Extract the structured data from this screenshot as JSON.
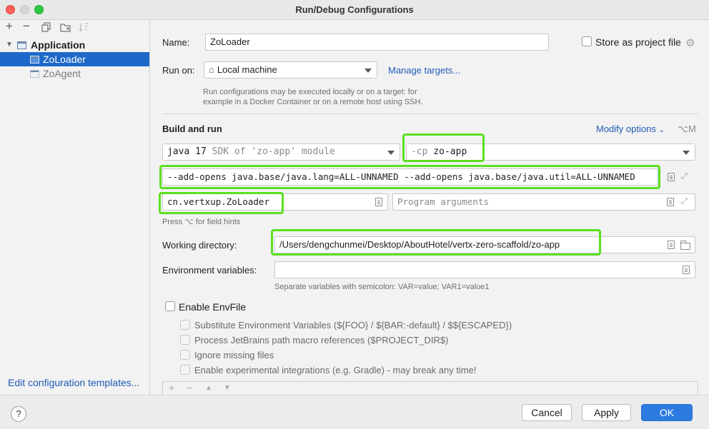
{
  "window": {
    "title": "Run/Debug Configurations"
  },
  "sidebar": {
    "toolbar": [
      "add-icon",
      "remove-icon",
      "copy-icon",
      "new-folder-icon",
      "sort-icon"
    ],
    "tree": {
      "group_label": "Application",
      "items": [
        {
          "label": "ZoLoader",
          "selected": true
        },
        {
          "label": "ZoAgent",
          "selected": false
        }
      ]
    },
    "edit_templates_link": "Edit configuration templates..."
  },
  "form": {
    "name_label": "Name:",
    "name_value": "ZoLoader",
    "store_as_project_label": "Store as project file",
    "run_on_label": "Run on:",
    "run_on_value": "Local machine",
    "manage_targets_link": "Manage targets...",
    "run_on_hint_line1": "Run configurations may be executed locally or on a target: for",
    "run_on_hint_line2": "example in a Docker Container or on a remote host using SSH.",
    "build_run_title": "Build and run",
    "modify_options_link": "Modify options",
    "modify_options_shortcut": "⌥M",
    "jdk_version": "java 17",
    "jdk_description": "SDK of 'zo-app' module",
    "cp_prefix": "-cp",
    "cp_value": "zo-app",
    "vm_options": "--add-opens java.base/java.lang=ALL-UNNAMED --add-opens java.base/java.util=ALL-UNNAMED",
    "main_class": "cn.vertxup.ZoLoader",
    "program_args_placeholder": "Program arguments",
    "field_hint": "Press ⌥ for field hints",
    "working_dir_label": "Working directory:",
    "working_dir_value": "/Users/dengchunmei/Desktop/AboutHotel/vertx-zero-scaffold/zo-app",
    "env_vars_label": "Environment variables:",
    "env_vars_value": "",
    "env_vars_hint": "Separate variables with semicolon: VAR=value; VAR1=value1",
    "enable_envfile_label": "Enable EnvFile",
    "envfile_options": [
      "Substitute Environment Variables (${FOO} / ${BAR:-default} / $${ESCAPED})",
      "Process JetBrains path macro references ($PROJECT_DIR$)",
      "Ignore missing files",
      "Enable experimental integrations (e.g. Gradle) - may break any time!"
    ]
  },
  "buttons": {
    "cancel": "Cancel",
    "apply": "Apply",
    "ok": "OK",
    "help": "?"
  },
  "colors": {
    "accent": "#2d7be0",
    "selection": "#1d68c9",
    "highlight": "#5be01f",
    "link": "#1f5bb5"
  }
}
